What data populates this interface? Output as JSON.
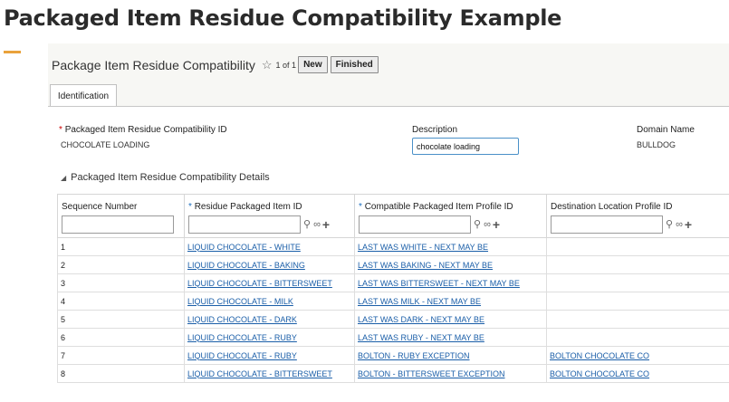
{
  "page": {
    "title": "Packaged Item Residue Compatibility Example"
  },
  "form": {
    "title": "Package Item Residue Compatibility",
    "paging": "1 of 1",
    "new_label": "New",
    "finished_label": "Finished"
  },
  "tabs": [
    {
      "label": "Identification"
    }
  ],
  "fields": {
    "id_label": "Packaged Item Residue Compatibility ID",
    "id_value": "CHOCOLATE LOADING",
    "desc_label": "Description",
    "desc_value": "chocolate loading",
    "domain_label": "Domain Name",
    "domain_value": "BULLDOG"
  },
  "details": {
    "title": "Packaged Item Residue Compatibility Details",
    "columns": [
      "Sequence Number",
      "Residue Packaged Item ID",
      "Compatible Packaged Item Profile ID",
      "Destination Location Profile ID"
    ],
    "rows": [
      {
        "seq": "1",
        "residue": "LIQUID CHOCOLATE - WHITE",
        "compatible": "LAST WAS WHITE - NEXT MAY BE",
        "destination": ""
      },
      {
        "seq": "2",
        "residue": "LIQUID CHOCOLATE - BAKING",
        "compatible": "LAST WAS BAKING - NEXT MAY BE",
        "destination": ""
      },
      {
        "seq": "3",
        "residue": "LIQUID CHOCOLATE - BITTERSWEET",
        "compatible": "LAST WAS BITTERSWEET - NEXT MAY BE",
        "destination": ""
      },
      {
        "seq": "4",
        "residue": "LIQUID CHOCOLATE - MILK",
        "compatible": "LAST WAS MILK - NEXT MAY BE",
        "destination": ""
      },
      {
        "seq": "5",
        "residue": "LIQUID CHOCOLATE - DARK",
        "compatible": "LAST WAS DARK - NEXT MAY BE",
        "destination": ""
      },
      {
        "seq": "6",
        "residue": "LIQUID CHOCOLATE - RUBY",
        "compatible": "LAST WAS RUBY - NEXT MAY BE",
        "destination": ""
      },
      {
        "seq": "7",
        "residue": "LIQUID CHOCOLATE - RUBY",
        "compatible": "BOLTON - RUBY EXCEPTION",
        "destination": "BOLTON CHOCOLATE CO"
      },
      {
        "seq": "8",
        "residue": "LIQUID CHOCOLATE - BITTERSWEET",
        "compatible": "BOLTON - BITTERSWEET EXCEPTION",
        "destination": "BOLTON CHOCOLATE CO"
      }
    ]
  },
  "colors": {
    "accent": "#e9a23b",
    "link": "#1a5ea8",
    "required": "#cc0000",
    "required_alt": "#1e6fbf"
  },
  "icons": {
    "favorite": "star-icon",
    "search": "search-icon",
    "glasses": "glasses-icon",
    "add": "plus-icon",
    "collapse": "triangle-down-icon"
  }
}
